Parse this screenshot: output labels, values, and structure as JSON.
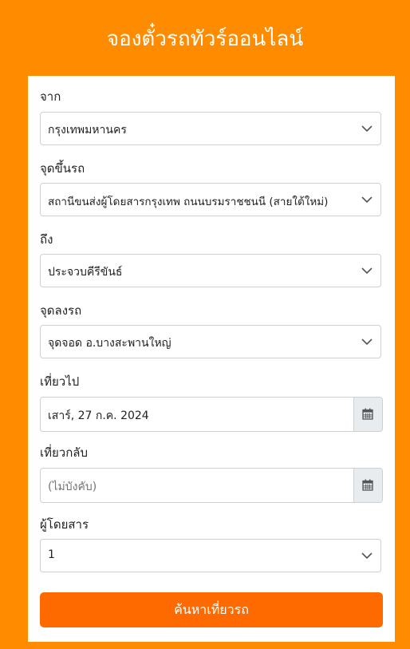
{
  "title": "จองตั๋วรถทัวร์ออนไลน์",
  "form": {
    "from_label": "จาก",
    "from_value": "กรุงเทพมหานคร",
    "pickup_label": "จุดขึ้นรถ",
    "pickup_value": "สถานีขนส่งผู้โดยสารกรุงเทพ ถนนบรมราชชนนี (สายใต้ใหม่)",
    "to_label": "ถึง",
    "to_value": "ประจวบคีรีขันธ์",
    "dropoff_label": "จุดลงรถ",
    "dropoff_value": "จุดจอด อ.บางสะพานใหญ่",
    "depart_label": "เที่ยวไป",
    "depart_value": "เสาร์, 27 ก.ค. 2024",
    "return_label": "เที่ยวกลับ",
    "return_placeholder": "(ไม่บังคับ)",
    "passengers_label": "ผู้โดยสาร",
    "passengers_value": "1",
    "search_button": "ค้นหาเที่ยวรถ"
  },
  "colors": {
    "background": "#ff8c00",
    "button": "#ff6a00",
    "calendar_bg": "#e9ecef"
  },
  "icons": {
    "dropdown": "chevron-down-icon",
    "calendar": "calendar-icon"
  }
}
